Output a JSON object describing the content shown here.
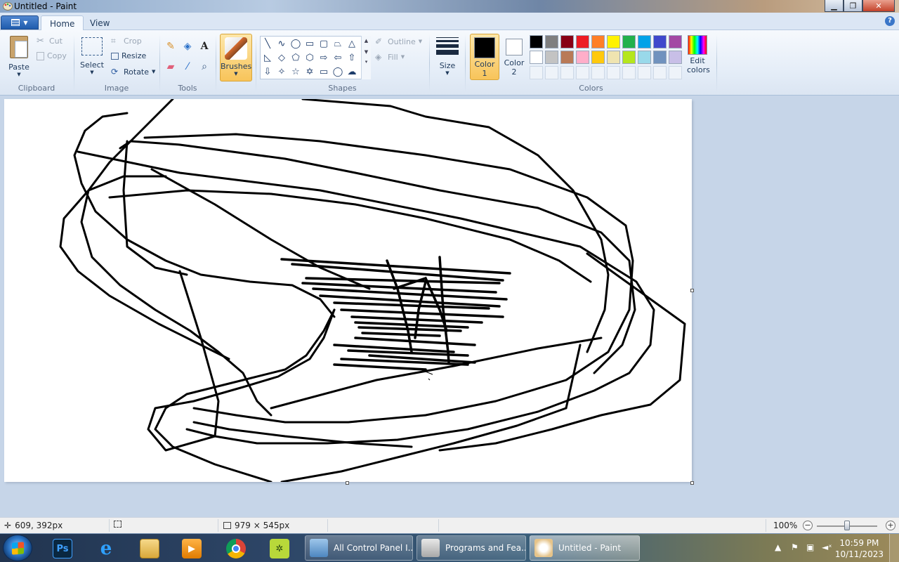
{
  "window": {
    "title": "Untitled - Paint"
  },
  "tabs": {
    "home": "Home",
    "view": "View"
  },
  "clipboard": {
    "group": "Clipboard",
    "paste": "Paste",
    "cut": "Cut",
    "copy": "Copy"
  },
  "image": {
    "group": "Image",
    "select": "Select",
    "crop": "Crop",
    "resize": "Resize",
    "rotate": "Rotate"
  },
  "tools": {
    "group": "Tools"
  },
  "brushes": {
    "label": "Brushes"
  },
  "shapes": {
    "group": "Shapes",
    "outline": "Outline",
    "fill": "Fill",
    "items": [
      "line-icon",
      "curve-icon",
      "oval-icon",
      "rectangle-icon",
      "rounded-rectangle-icon",
      "polygon-icon",
      "triangle-icon",
      "right-triangle-icon",
      "diamond-icon",
      "pentagon-icon",
      "hexagon-icon",
      "right-arrow-icon",
      "left-arrow-icon",
      "up-arrow-icon",
      "down-arrow-icon",
      "four-point-star-icon",
      "five-point-star-icon",
      "six-point-star-icon",
      "rounded-callout-icon",
      "oval-callout-icon",
      "cloud-callout-icon"
    ]
  },
  "size": {
    "label": "Size"
  },
  "colors": {
    "group": "Colors",
    "color1_label_a": "Color",
    "color1_label_b": "1",
    "color2_label_a": "Color",
    "color2_label_b": "2",
    "color1": "#000000",
    "color2": "#ffffff",
    "edit_a": "Edit",
    "edit_b": "colors",
    "palette_row1": [
      "#000000",
      "#7f7f7f",
      "#880015",
      "#ed1c24",
      "#ff7f27",
      "#fff200",
      "#22b14c",
      "#00a2e8",
      "#3f48cc",
      "#a349a4"
    ],
    "palette_row2": [
      "#ffffff",
      "#c3c3c3",
      "#b97a57",
      "#ffaec9",
      "#ffc90e",
      "#efe4b0",
      "#b5e61d",
      "#99d9ea",
      "#7092be",
      "#c8bfe7"
    ]
  },
  "status": {
    "cursor_pos": "609, 392px",
    "canvas_size": "979 × 545px",
    "zoom": "100%",
    "zoom_fraction": 0.5
  },
  "taskbar": {
    "pinned": [
      "photoshop-icon",
      "internet-explorer-icon",
      "file-explorer-icon",
      "media-player-icon",
      "chrome-icon",
      "game-icon"
    ],
    "tasks": [
      {
        "label": "All Control Panel I..."
      },
      {
        "label": "Programs and Fea..."
      },
      {
        "label": "Untitled - Paint"
      }
    ],
    "time": "10:59 PM",
    "date": "10/11/2023"
  }
}
